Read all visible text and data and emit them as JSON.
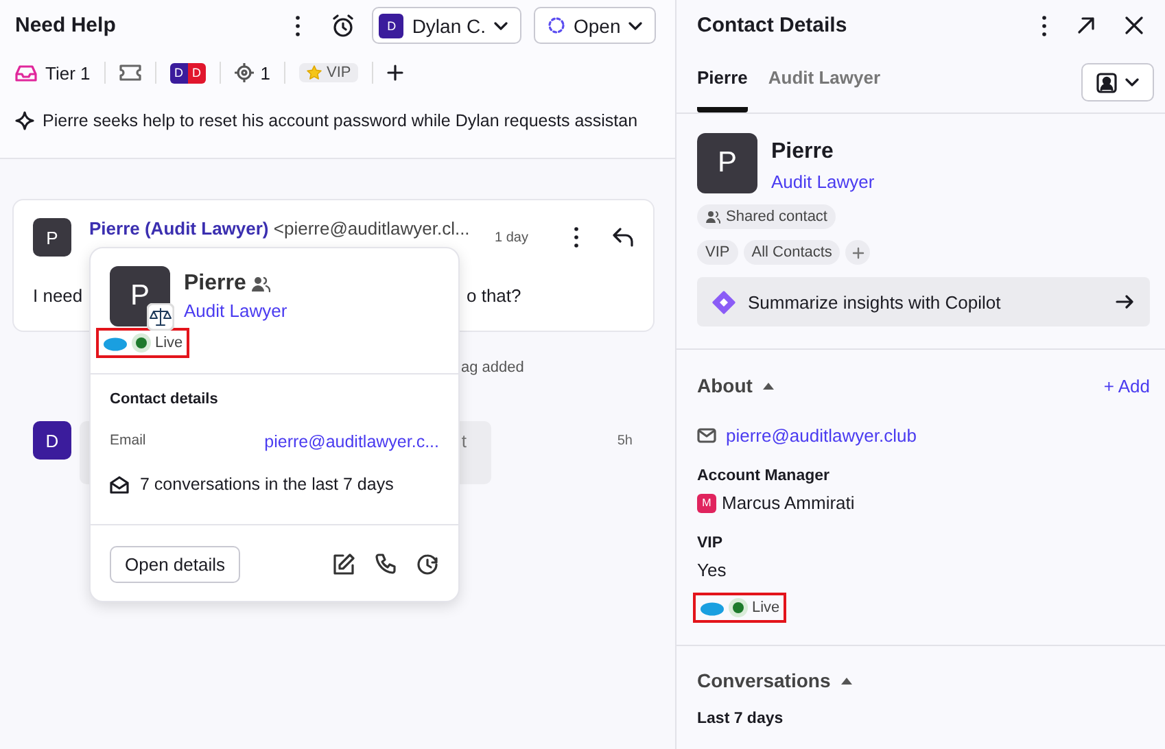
{
  "header": {
    "title": "Need Help",
    "assignee": {
      "initial": "D",
      "name": "Dylan C."
    },
    "status": "Open"
  },
  "tags_bar": {
    "inbox": "Tier 1",
    "avatars": [
      {
        "initial": "D",
        "color": "#3b1c9c"
      },
      {
        "initial": "D",
        "color": "#e1162d"
      }
    ],
    "targets": "1",
    "vip": "VIP"
  },
  "summary": "Pierre seeks help to reset his account password while Dylan requests assistan",
  "message": {
    "avatar": "P",
    "sender": "Pierre (Audit Lawyer)",
    "email": "<pierre@auditlawyer.cl...",
    "time": "1 day",
    "body_start": "I need",
    "body_end": "o that?"
  },
  "event_note": "ag added",
  "reply": {
    "avatar": "D",
    "fragment": "t",
    "time": "5h"
  },
  "popover": {
    "avatar": "P",
    "name": "Pierre",
    "subtitle": "Audit Lawyer",
    "live": {
      "label": "Live",
      "highlighted": true
    },
    "section": "Contact details",
    "email_label": "Email",
    "email": "pierre@auditlawyer.c...",
    "conversations": "7 conversations in the last 7 days",
    "open_button": "Open details"
  },
  "details": {
    "title": "Contact Details",
    "tabs": [
      {
        "label": "Pierre",
        "selected": true
      },
      {
        "label": "Audit Lawyer",
        "selected": false
      }
    ],
    "avatar": "P",
    "name": "Pierre",
    "subtitle": "Audit Lawyer",
    "shared_chip": "Shared contact",
    "tags": [
      "VIP",
      "All Contacts"
    ],
    "copilot": "Summarize insights with Copilot",
    "about": {
      "title": "About",
      "expanded": true,
      "add": "+ Add",
      "email": "pierre@auditlawyer.club",
      "fields": [
        {
          "label": "Account Manager",
          "kind": "person",
          "initial": "M",
          "value": "Marcus Ammirati"
        },
        {
          "label": "VIP",
          "kind": "text",
          "value": "Yes"
        }
      ],
      "live": {
        "label": "Live",
        "highlighted": true
      }
    },
    "conversations": {
      "title": "Conversations",
      "expanded": true,
      "subtitle": "Last 7 days"
    }
  }
}
